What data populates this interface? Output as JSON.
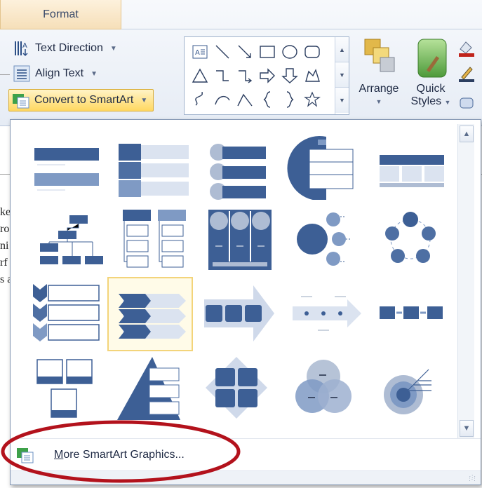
{
  "ribbon": {
    "format_tab": "Format",
    "text_direction": "Text Direction",
    "align_text": "Align Text",
    "convert_to_smartart": "Convert to SmartArt",
    "arrange": "Arrange",
    "quick_styles_line1": "Quick",
    "quick_styles_line2": "Styles",
    "shape_gallery_icons": [
      "text-box-icon",
      "line-icon",
      "arrow-line-icon",
      "rectangle-icon",
      "oval-icon",
      "rounded-rectangle-icon",
      "triangle-icon",
      "elbow-connector-icon",
      "elbow-arrow-connector-icon",
      "right-arrow-icon",
      "down-arrow-icon",
      "freeform-icon",
      "curve-icon",
      "arc-icon",
      "free-curve-icon",
      "left-brace-icon",
      "right-brace-icon",
      "star-icon"
    ]
  },
  "document": {
    "fragments": [
      "ke",
      "ro",
      "ni",
      "rf",
      "s a"
    ]
  },
  "smartart_gallery": {
    "layouts": [
      "vertical-bullet-list",
      "vertical-box-list",
      "vertical-circle-list",
      "nested-target-list",
      "table-list",
      "organization-chart",
      "hierarchy-list",
      "picture-accent-list",
      "radial-cluster",
      "cycle-matrix",
      "vertical-chevron-list",
      "horizontal-arrow-list",
      "process-arrows",
      "timeline-arrow",
      "basic-process",
      "picture-caption",
      "pyramid-list",
      "matrix-cycle",
      "venn-diagram",
      "target-list"
    ],
    "selected_index": 11,
    "more_label_access_key": "M",
    "more_label_rest": "ore SmartArt Graphics..."
  },
  "colors": {
    "accent_blue": "#3d5f95",
    "light_blue": "#9cb1d3",
    "highlight": "#f3d47a",
    "annotation_red": "#b3121c"
  }
}
